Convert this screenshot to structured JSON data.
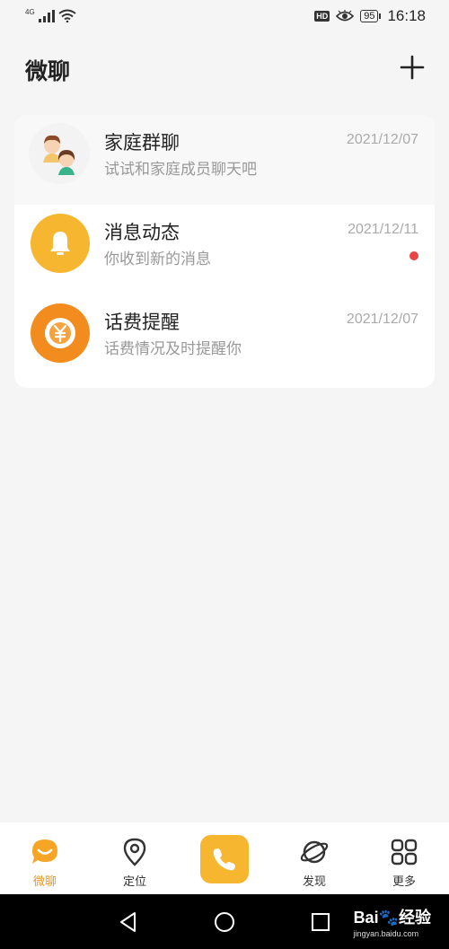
{
  "status_bar": {
    "network": "4G",
    "hd_label": "HD",
    "battery": "95",
    "time": "16:18"
  },
  "header": {
    "title": "微聊",
    "add_icon": "plus-icon"
  },
  "chats": [
    {
      "title": "家庭群聊",
      "subtitle": "试试和家庭成员聊天吧",
      "date": "2021/12/07",
      "icon": "family-avatar",
      "unread": false
    },
    {
      "title": "消息动态",
      "subtitle": "你收到新的消息",
      "date": "2021/12/11",
      "icon": "bell-icon",
      "unread": true
    },
    {
      "title": "话费提醒",
      "subtitle": "话费情况及时提醒你",
      "date": "2021/12/07",
      "icon": "yuan-icon",
      "unread": false
    }
  ],
  "bottom_nav": {
    "items": [
      {
        "label": "微聊",
        "icon": "chat-bubble-icon",
        "active": true
      },
      {
        "label": "定位",
        "icon": "location-pin-icon",
        "active": false
      },
      {
        "label": "",
        "icon": "phone-icon",
        "active": false
      },
      {
        "label": "发现",
        "icon": "planet-icon",
        "active": false
      },
      {
        "label": "更多",
        "icon": "grid-icon",
        "active": false
      }
    ]
  },
  "watermark": {
    "brand": "Bai",
    "brand_suffix": "经验",
    "url": "jingyan.baidu.com"
  },
  "colors": {
    "accent": "#f7b62f",
    "orange": "#f28c1e",
    "unread": "#e94545",
    "active_label": "#e2961f"
  }
}
